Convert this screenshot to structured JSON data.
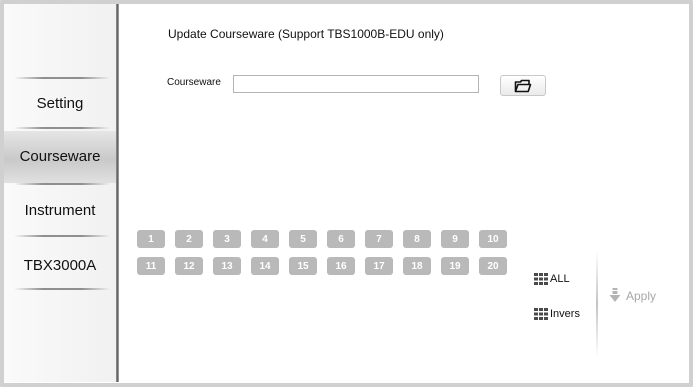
{
  "sidebar": {
    "items": [
      {
        "label": "Setting",
        "active": false
      },
      {
        "label": "Courseware",
        "active": true
      },
      {
        "label": "Instrument",
        "active": false
      },
      {
        "label": "TBX3000A",
        "active": false
      }
    ]
  },
  "main": {
    "title": "Update Courseware (Support TBS1000B-EDU only)",
    "courseware_label": "Courseware",
    "courseware_value": "",
    "open_icon": "folder-open-icon",
    "numbers_row1": [
      "1",
      "2",
      "3",
      "4",
      "5",
      "6",
      "7",
      "8",
      "9",
      "10"
    ],
    "numbers_row2": [
      "11",
      "12",
      "13",
      "14",
      "15",
      "16",
      "17",
      "18",
      "19",
      "20"
    ],
    "all_label": "ALL",
    "invers_label": "Invers",
    "apply_label": "Apply",
    "grid_icon": "grid-icon",
    "apply_icon": "arrow-down-icon"
  },
  "colors": {
    "number_button": "#b9b9b9",
    "apply_disabled": "#a8a8a8"
  }
}
